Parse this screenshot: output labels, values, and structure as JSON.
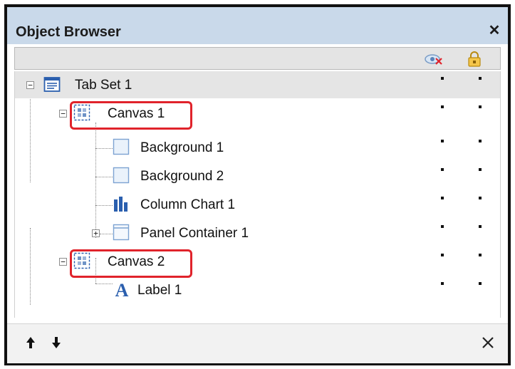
{
  "window": {
    "title": "Object Browser",
    "close_icon": "close-icon",
    "close_glyph": "✕"
  },
  "header": {
    "visibility_icon": "eye-hidden-icon",
    "lock_icon": "lock-icon"
  },
  "tree": {
    "items": [
      {
        "label": "Tab Set 1",
        "icon": "tab-set-icon",
        "expanded": true,
        "visible": true,
        "locked": false
      },
      {
        "label": "Canvas 1",
        "icon": "canvas-icon",
        "expanded": true,
        "highlighted": true
      },
      {
        "label": "Background 1",
        "icon": "background-icon"
      },
      {
        "label": "Background 2",
        "icon": "background-icon"
      },
      {
        "label": "Column Chart 1",
        "icon": "column-chart-icon"
      },
      {
        "label": "Panel Container 1",
        "icon": "panel-container-icon",
        "expanded": false
      },
      {
        "label": "Canvas 2",
        "icon": "canvas-icon",
        "expanded": true,
        "highlighted": true
      },
      {
        "label": "Label 1",
        "icon": "label-icon"
      }
    ]
  },
  "footer": {
    "move_up_icon": "arrow-up-icon",
    "move_down_icon": "arrow-down-icon",
    "delete_icon": "delete-icon"
  },
  "colors": {
    "title_bar": "#c9d9ea",
    "selected_row": "#e5e5e5",
    "highlight_border": "#e0232b",
    "icon_blue": "#2b5fae"
  }
}
